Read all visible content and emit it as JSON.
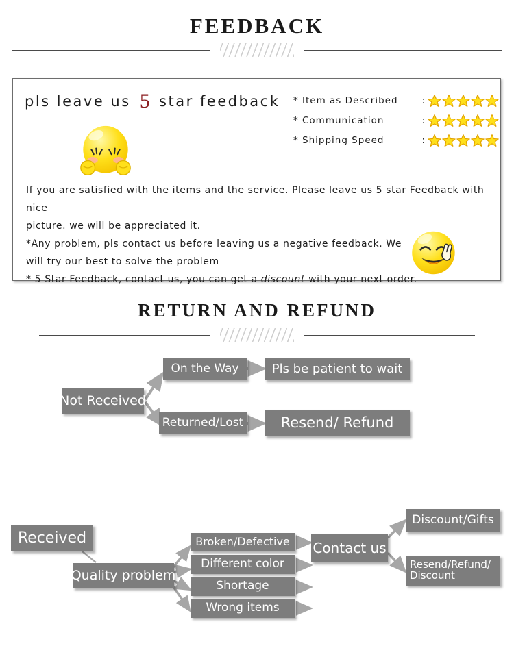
{
  "sections": {
    "feedback": {
      "title": "FEEDBACK",
      "headline_before": "pls leave us ",
      "headline_number": "5",
      "headline_after": " star feedback",
      "ratings": [
        {
          "asterisk": "*",
          "label": "Item as Described",
          "colon": ":",
          "stars": 5
        },
        {
          "asterisk": "*",
          "label": "Communication",
          "colon": ":",
          "stars": 5
        },
        {
          "asterisk": "*",
          "label": "Shipping Speed",
          "colon": ":",
          "stars": 5
        }
      ],
      "paragraph_lines": [
        "If you are satisfied with the items and the service. Please leave us 5 star Feedback with nice",
        "picture. we will be appreciated it.",
        "*Any problem, pls contact us before leaving us a negative feedback. We",
        "will try our best to solve  the problem",
        "* 5 Star Feedback, contact us, you can get a ",
        "discount",
        " with your next order."
      ]
    },
    "return": {
      "title": "RETURN AND REFUND"
    }
  },
  "flow_return": {
    "nodes": [
      {
        "id": "not-received",
        "label": "Not Received"
      },
      {
        "id": "on-the-way",
        "label": "On the Way"
      },
      {
        "id": "pls-be-patient",
        "label": "Pls be patient to wait"
      },
      {
        "id": "returned-lost",
        "label": "Returned/Lost"
      },
      {
        "id": "resend-refund",
        "label": "Resend/ Refund"
      }
    ]
  },
  "flow_received": {
    "nodes": [
      {
        "id": "received",
        "label": "Received"
      },
      {
        "id": "quality-problem",
        "label": "Quality problem"
      },
      {
        "id": "broken-defective",
        "label": "Broken/Defective"
      },
      {
        "id": "different-color",
        "label": "Different color"
      },
      {
        "id": "shortage",
        "label": "Shortage"
      },
      {
        "id": "wrong-items",
        "label": "Wrong items"
      },
      {
        "id": "contact-us",
        "label": "Contact us"
      },
      {
        "id": "discount-gifts",
        "label": "Discount/Gifts"
      },
      {
        "id": "resend-refund-discount",
        "label": "Resend/Refund/\nDiscount"
      }
    ]
  },
  "colors": {
    "node_fill": "#7d7d7d",
    "node_text": "#ffffff",
    "arrow": "#a6a6a6",
    "star_fill": "#ffe01b",
    "star_stroke": "#e3a400",
    "accent_red": "#8c1f22",
    "box_border": "#6d6d6d"
  },
  "icons": {
    "star": "star-icon",
    "emoji_shy": "shy-face-emoji-icon",
    "emoji_peace": "smiling-peace-face-emoji-icon",
    "hatch": "hatch-divider-icon"
  }
}
